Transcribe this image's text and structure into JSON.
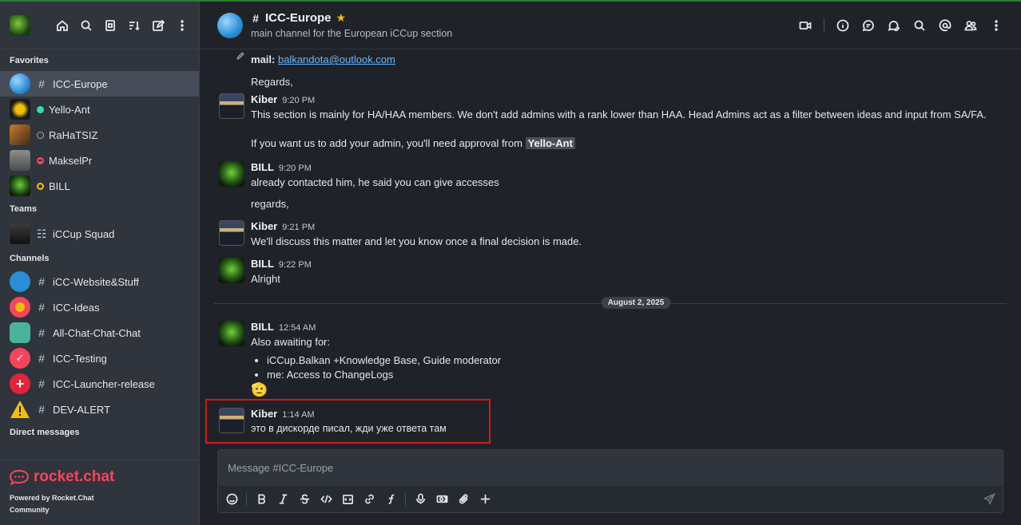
{
  "sidebar": {
    "sections": {
      "favorites": "Favorites",
      "teams": "Teams",
      "channels": "Channels",
      "direct": "Direct messages"
    },
    "favorites": [
      {
        "label": "ICC-Europe",
        "kind": "channel"
      },
      {
        "label": "Yello-Ant",
        "kind": "user",
        "status": "#2de0a5"
      },
      {
        "label": "RaHaTSIZ",
        "kind": "user",
        "status": "offline"
      },
      {
        "label": "MakselPr",
        "kind": "user",
        "status": "#f5455c"
      },
      {
        "label": "BILL",
        "kind": "user",
        "status": "#f3be08"
      }
    ],
    "teams": [
      {
        "label": "iCCup Squad"
      }
    ],
    "channels": [
      {
        "label": "iCC-Website&Stuff"
      },
      {
        "label": "ICC-Ideas"
      },
      {
        "label": "All-Chat-Chat-Chat"
      },
      {
        "label": "ICC-Testing"
      },
      {
        "label": "ICC-Launcher-release"
      },
      {
        "label": "DEV-ALERT"
      }
    ],
    "brand": "rocket.chat",
    "powered": "Powered by Rocket.Chat",
    "community": "Community"
  },
  "header": {
    "title": "ICC-Europe",
    "topic": "main channel for the European iCCup section"
  },
  "messages": {
    "m0": {
      "mail_label": "mail:",
      "mail": "balkandota@outlook.com",
      "regards": "Regards,"
    },
    "m1": {
      "user": "Kiber",
      "time": "9:20 PM",
      "text": "This section is mainly for HA/HAA members. We don't add admins with a rank lower than HAA. Head Admins act as a filter between ideas and input from SA/FA.",
      "text2": "If you want us to add your admin, you'll need approval from",
      "mention": "Yello-Ant"
    },
    "m2": {
      "user": "BILL",
      "time": "9:20 PM",
      "text": "already contacted him, he said you can give accesses",
      "text2": "regards,"
    },
    "m3": {
      "user": "Kiber",
      "time": "9:21 PM",
      "text": "We'll discuss this matter and let you know once a final decision is made."
    },
    "m4": {
      "user": "BILL",
      "time": "9:22 PM",
      "text": "Alright"
    },
    "date_divider": "August 2, 2025",
    "m5": {
      "user": "BILL",
      "time": "12:54 AM",
      "text": "Also awaiting for:",
      "bullets": [
        "iCCup.Balkan +Knowledge Base, Guide moderator",
        "me: Access to ChangeLogs"
      ],
      "emoji": "🫡"
    },
    "m6": {
      "user": "Kiber",
      "time": "1:14 AM",
      "text": "это в дискорде писал, жди уже ответа там"
    }
  },
  "composer": {
    "placeholder": "Message #ICC-Europe"
  },
  "colors": {
    "accent": "#f5455c",
    "highlight_border": "#d11a1a"
  }
}
